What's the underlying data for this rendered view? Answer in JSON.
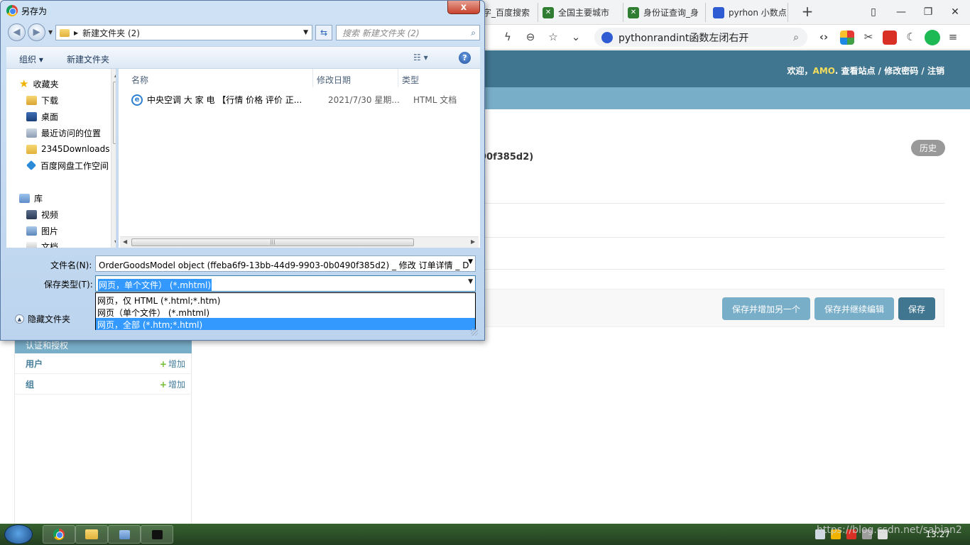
{
  "browser": {
    "tabs": [
      {
        "label": "字_百度搜索"
      },
      {
        "label": "全国主要城市"
      },
      {
        "label": "身份证查询_身"
      },
      {
        "label": "pyrhon 小数点"
      }
    ],
    "search_text": "pythonrandint函数左闭右开"
  },
  "admin": {
    "user_tools": {
      "welcome": "欢迎，",
      "username": "AMO",
      "view_site": ". 查看站点",
      "sep1": " / ",
      "change_password": "修改密码",
      "sep2": " / ",
      "logout": "注销"
    },
    "history_button": "历史",
    "object_title_fragment": "90f385d2)",
    "buttons": {
      "save_add_another": "保存并增加另一个",
      "save_continue": "保存并继续编辑",
      "save": "保存"
    },
    "sidebar": {
      "caption": "认证和授权",
      "models": [
        {
          "name": "用户",
          "add_label": "增加"
        },
        {
          "name": "组",
          "add_label": "增加"
        }
      ],
      "add_plus": "+"
    }
  },
  "dialog": {
    "title": "另存为",
    "close_glyph": "x",
    "path": "新建文件夹 (2)",
    "search_placeholder": "搜索 新建文件夹 (2)",
    "toolbar": {
      "organize": "组织 ▾",
      "new_folder": "新建文件夹",
      "view_glyph": "☷ ▾",
      "help_glyph": "?"
    },
    "nav": {
      "favorites": "收藏夹",
      "downloads": "下载",
      "desktop": "桌面",
      "recent": "最近访问的位置",
      "folder_2345": "2345Downloads",
      "baidu": "百度网盘工作空间",
      "libraries": "库",
      "videos": "视频",
      "pictures": "图片",
      "documents": "文档"
    },
    "columns": {
      "name": "名称",
      "date": "修改日期",
      "type": "类型"
    },
    "files": [
      {
        "name": "中央空调 大 家 电 【行情 价格 评价 正...",
        "date": "2021/7/30 星期...",
        "type": "HTML 文档"
      }
    ],
    "filename_label": "文件名(N):",
    "filename_value": "OrderGoodsModel object (ffeba6f9-13bb-44d9-9903-0b0490f385d2) _ 修改 订单详情 _ D",
    "savetype_label": "保存类型(T):",
    "savetype_selected": "网页，单个文件） (*.mhtml)",
    "savetype_options": [
      {
        "label": "网页，仅 HTML (*.html;*.htm)"
      },
      {
        "label": "网页（单个文件） (*.mhtml)"
      },
      {
        "label": "网页，全部 (*.htm;*.html)"
      }
    ],
    "hide_folders": "隐藏文件夹"
  },
  "taskbar": {
    "clock": "13:27",
    "watermark": "https://blog.csdn.net/sabian2"
  }
}
